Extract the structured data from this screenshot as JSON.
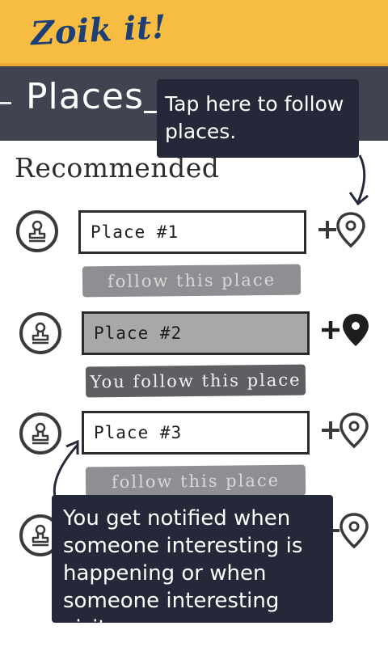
{
  "header": {
    "app_title": "Zoik it!"
  },
  "titlebar": {
    "page_title": "Places"
  },
  "section": {
    "title": "Recommended"
  },
  "places": [
    {
      "name": "Place #1",
      "follow_label": "follow this place",
      "followed": false
    },
    {
      "name": "Place #2",
      "follow_label": "You follow this place",
      "followed": true
    },
    {
      "name": "Place #3",
      "follow_label": "follow this place",
      "followed": false
    }
  ],
  "tooltips": {
    "follow_hint": "Tap here to follow places.",
    "notify_hint": "You get notified when someone interesting is happening or when someone interesting visits."
  },
  "icons": {
    "place_avatar": "stamp-icon",
    "follow": "add-location-icon",
    "followed": "add-location-filled-icon"
  },
  "colors": {
    "header_bg": "#f6bd42",
    "title_color": "#1d3f76",
    "titlebar_bg": "#404450",
    "tooltip_bg": "#252838",
    "follow_button": "#8f8f93",
    "followed_button": "#5e5f63",
    "followed_box": "#a8a8a8"
  }
}
